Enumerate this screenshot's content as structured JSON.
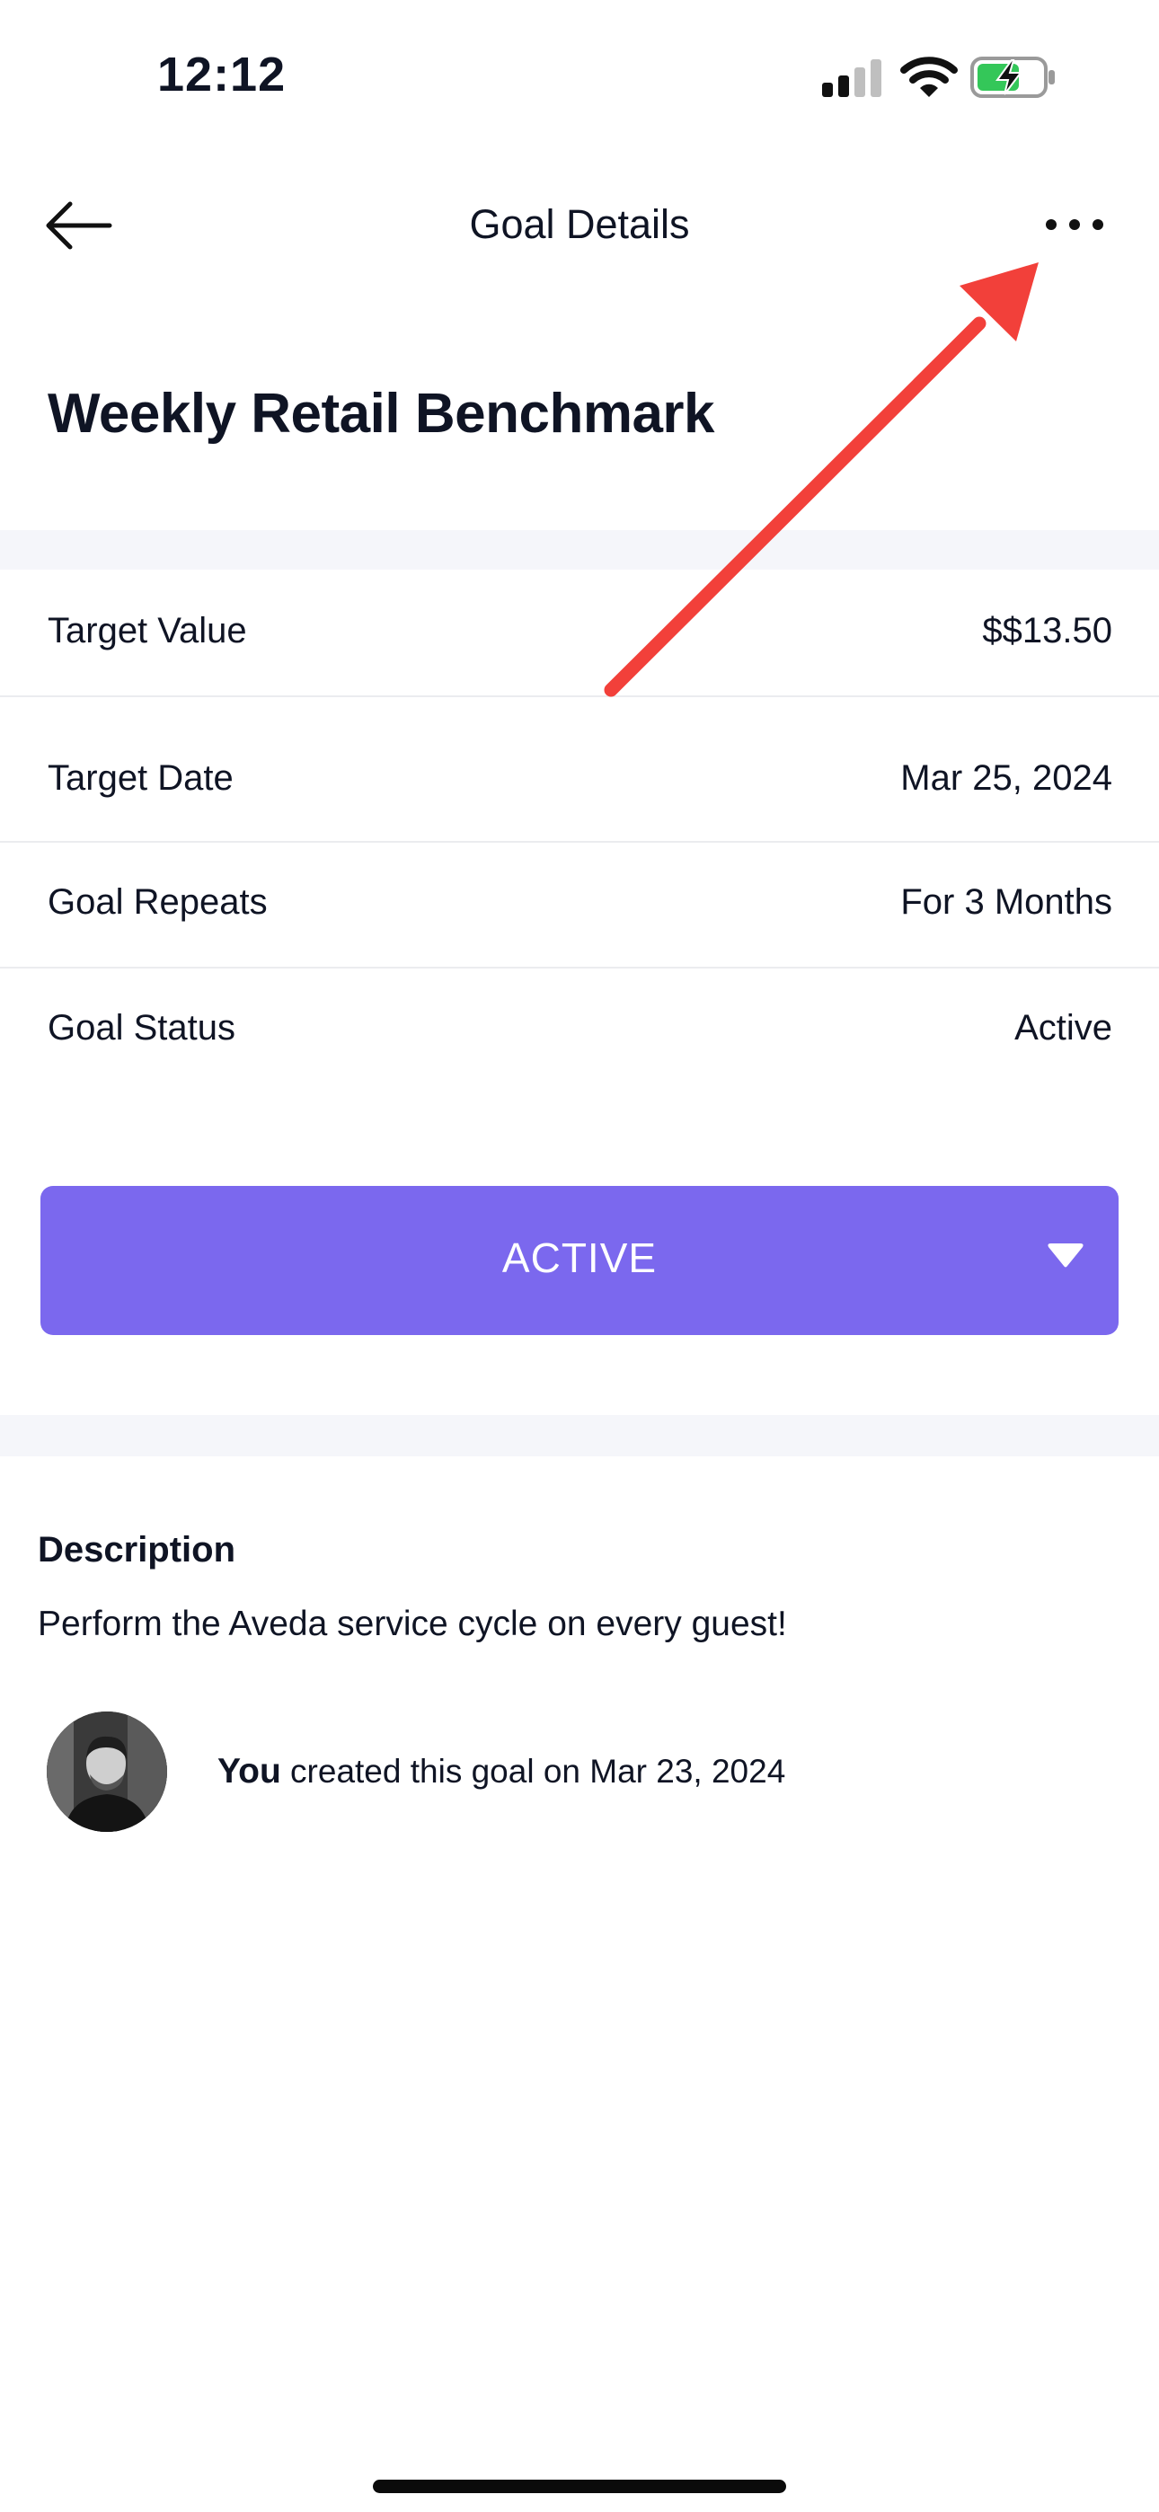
{
  "status_bar": {
    "time": "12:12"
  },
  "nav": {
    "title": "Goal Details"
  },
  "goal": {
    "title": "Weekly Retail Benchmark",
    "details": [
      {
        "label": "Target Value",
        "value": "$$13.50"
      },
      {
        "label": "Target Date",
        "value": "Mar 25, 2024"
      },
      {
        "label": "Goal Repeats",
        "value": "For 3 Months"
      },
      {
        "label": "Goal Status",
        "value": "Active"
      }
    ],
    "status_button": "ACTIVE",
    "description_heading": "Description",
    "description": "Perform the Aveda service cycle on every guest!",
    "creator": {
      "name": "You",
      "action": "created this goal on Mar 23, 2024"
    }
  },
  "colors": {
    "accent": "#7b68ee",
    "annotation_arrow": "#f2403a"
  },
  "icons": [
    "back-arrow-icon",
    "more-icon",
    "chevron-down-icon",
    "signal-icon",
    "wifi-icon",
    "battery-icon"
  ]
}
